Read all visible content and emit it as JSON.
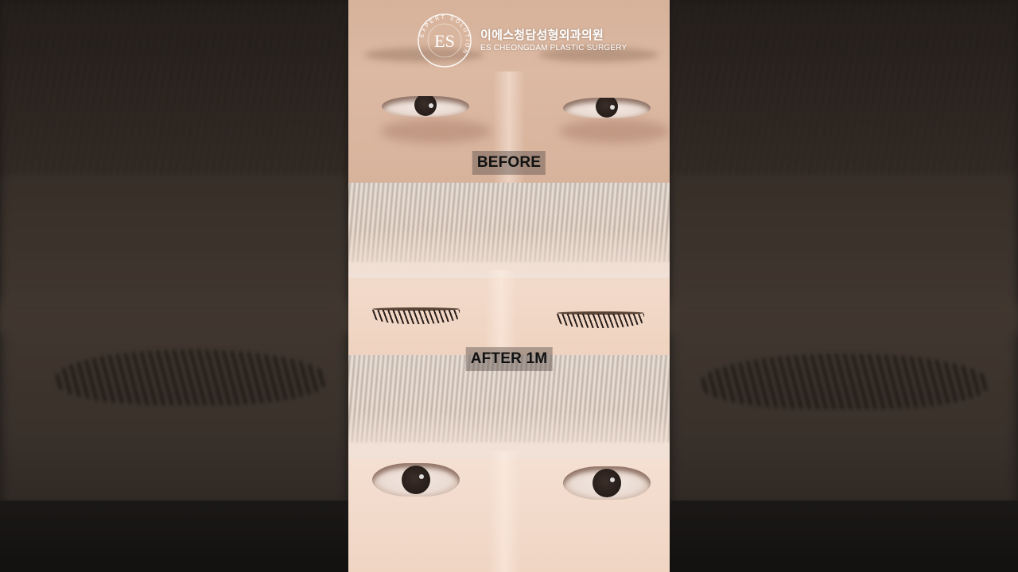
{
  "logo": {
    "monogram": "ES",
    "ring_text": "EXPERT SOLUTION",
    "name_korean": "이에스청담성형외과의원",
    "name_english": "ES CHEONGDAM PLASTIC SURGERY"
  },
  "labels": {
    "before": "BEFORE",
    "after": "AFTER 1M"
  },
  "disclaimer": "",
  "colors": {
    "label_bg": "#5a504b",
    "label_text": "#111111",
    "logo_text": "#ffffff",
    "backdrop": "#2a2725"
  }
}
